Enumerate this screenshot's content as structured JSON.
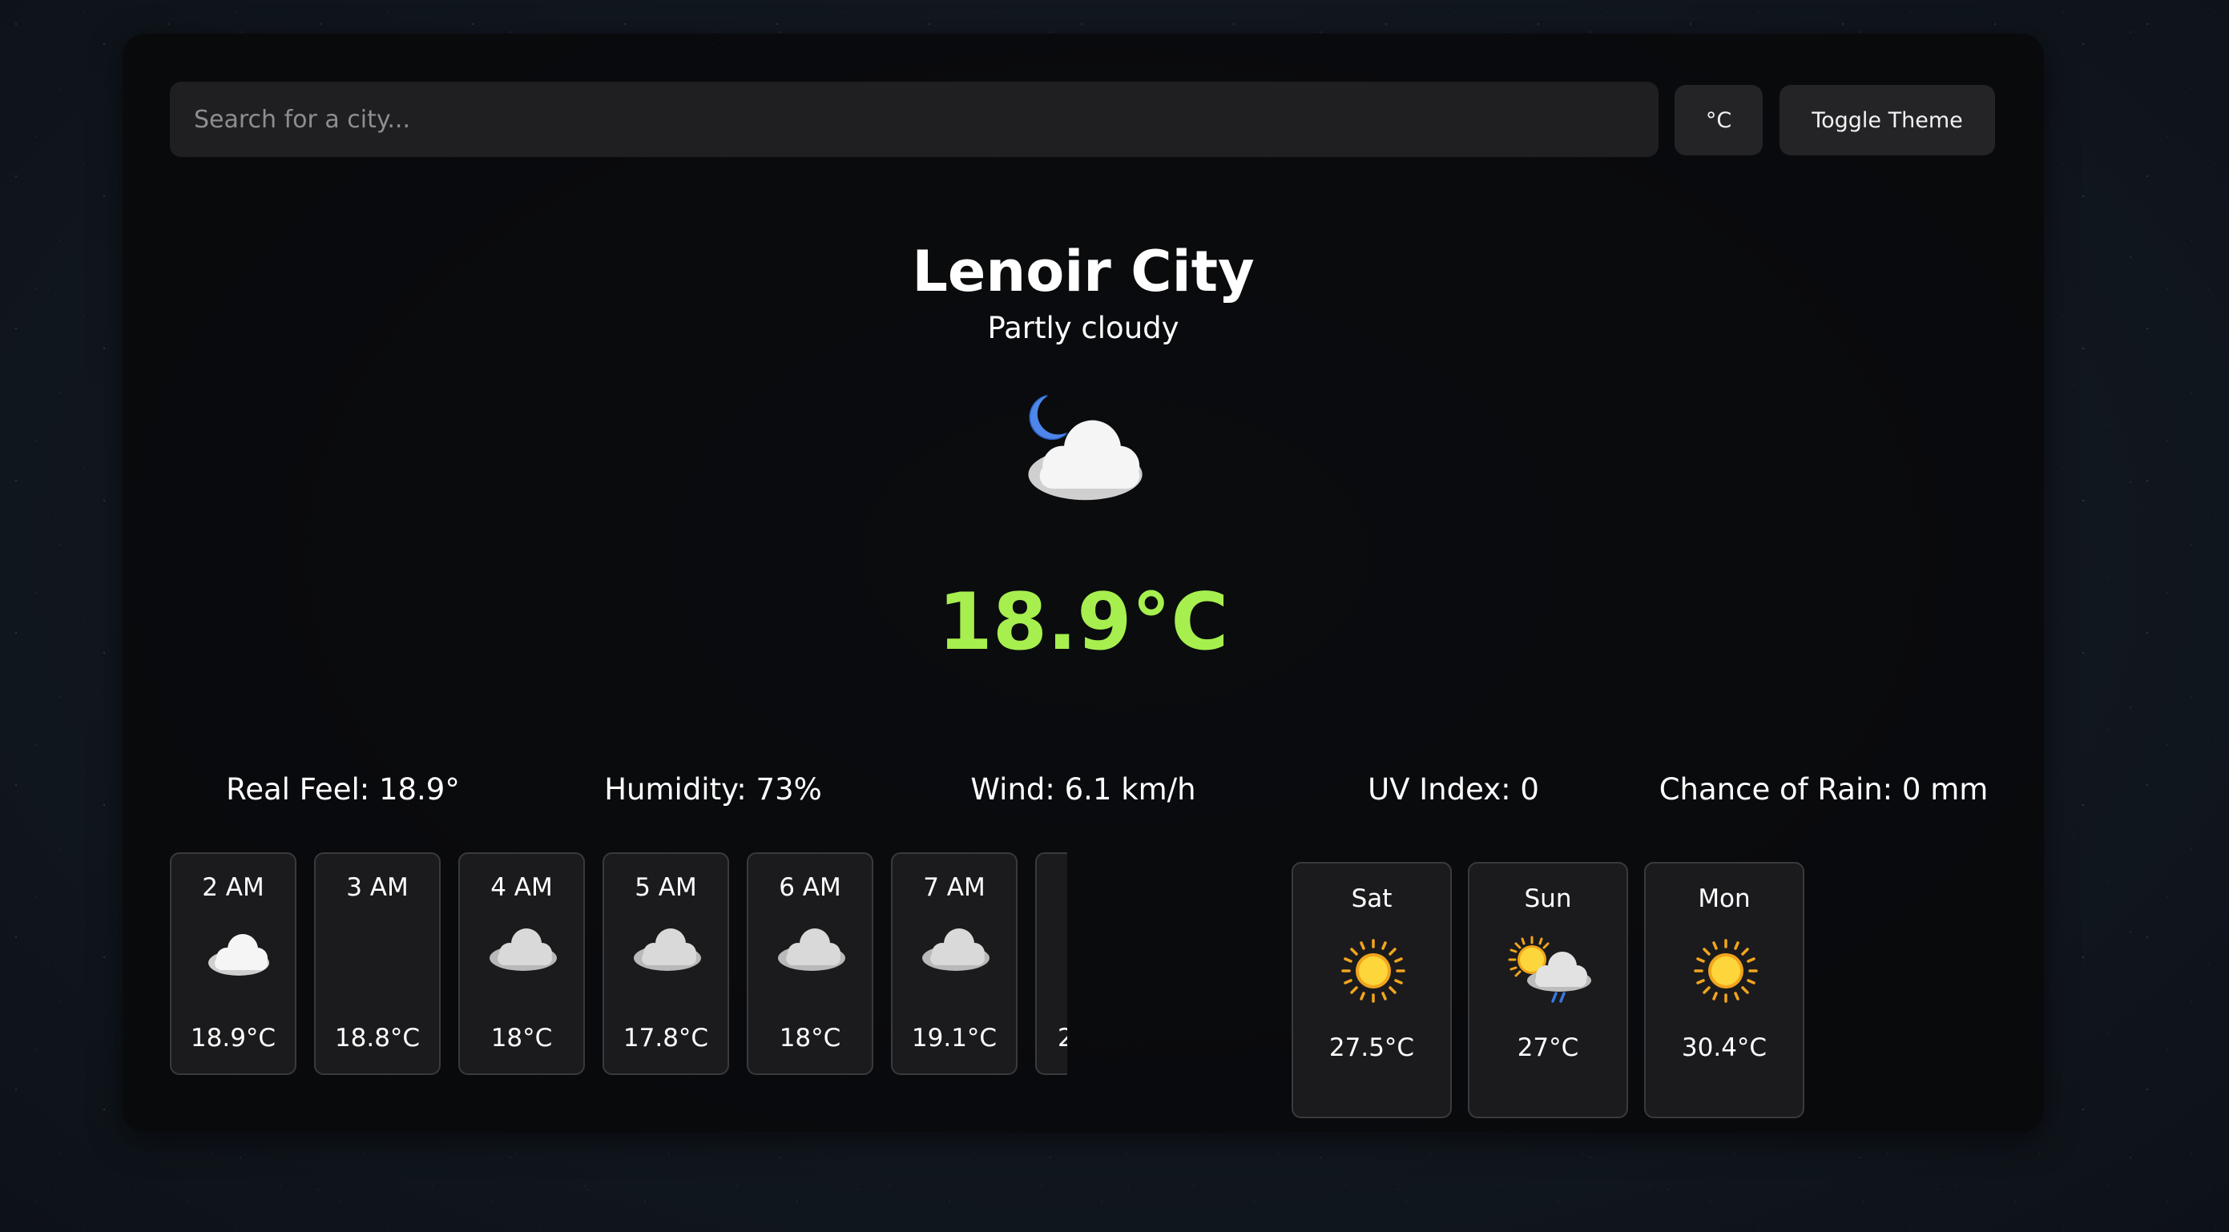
{
  "search": {
    "placeholder": "Search for a city..."
  },
  "controls": {
    "unit_label": "°C",
    "theme_label": "Toggle Theme"
  },
  "current": {
    "city": "Lenoir City",
    "condition": "Partly cloudy",
    "icon": "moon-cloud-icon",
    "temperature": "18.9°C",
    "temperature_color": "#a6ef4f"
  },
  "stats": {
    "real_feel": "Real Feel: 18.9°",
    "humidity": "Humidity: 73%",
    "wind": "Wind: 6.1 km/h",
    "uv_index": "UV Index: 0",
    "chance_of_rain": "Chance of Rain: 0 mm"
  },
  "hourly": [
    {
      "time": "2 AM",
      "icon": "moon-cloud-icon",
      "temp": "18.9°C"
    },
    {
      "time": "3 AM",
      "icon": "moon-icon",
      "temp": "18.8°C"
    },
    {
      "time": "4 AM",
      "icon": "cloud-icon",
      "temp": "18°C"
    },
    {
      "time": "5 AM",
      "icon": "cloud-icon",
      "temp": "17.8°C"
    },
    {
      "time": "6 AM",
      "icon": "cloud-icon",
      "temp": "18°C"
    },
    {
      "time": "7 AM",
      "icon": "cloud-icon",
      "temp": "19.1°C"
    },
    {
      "time": "",
      "icon": "",
      "temp": "2"
    }
  ],
  "daily": [
    {
      "day": "Sat",
      "icon": "sun-icon",
      "temp": "27.5°C"
    },
    {
      "day": "Sun",
      "icon": "sun-cloud-rain-icon",
      "temp": "27°C"
    },
    {
      "day": "Mon",
      "icon": "sun-icon",
      "temp": "30.4°C"
    }
  ]
}
